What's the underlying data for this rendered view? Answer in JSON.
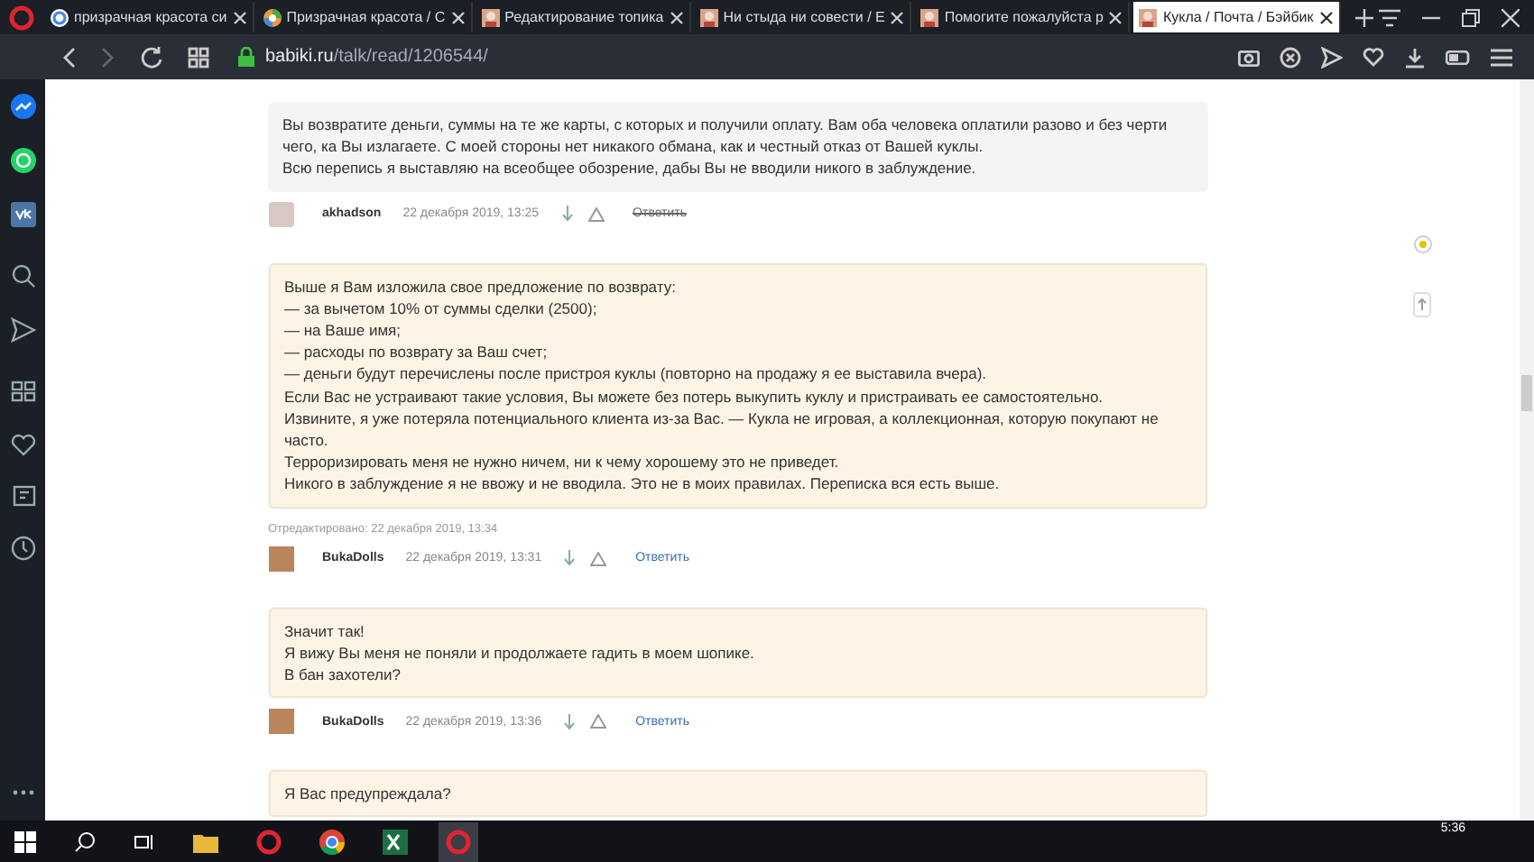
{
  "browser": {
    "tabs": [
      {
        "title": "призрачная красота си",
        "selected": false,
        "kind": "g"
      },
      {
        "title": "Призрачная красота / С",
        "selected": false,
        "kind": "wheel"
      },
      {
        "title": "Редактирование топика",
        "selected": false,
        "kind": "site"
      },
      {
        "title": "Ни стыда ни совести / Е",
        "selected": false,
        "kind": "site"
      },
      {
        "title": "Помогите пожалуйста р",
        "selected": false,
        "kind": "site"
      },
      {
        "title": "Кукла / Почта / Бэйбик",
        "selected": true,
        "kind": "site"
      }
    ],
    "address": {
      "host": "babiki.ru",
      "path": "/talk/read/1206544/"
    }
  },
  "comments": [
    {
      "kind": "other",
      "paragraphs": [
        "Вы возвратите деньги, суммы на те же карты, с которых и получили оплату. Вам оба человека оплатили разово и без черти чего, ка Вы излагаете. С моей стороны нет никакого обмана, как и честный отказ от Вашей куклы.",
        "Всю перепись я выставляю на всеобщее обозрение, дабы Вы не вводили никого в заблуждение."
      ],
      "author": "akhadson",
      "date": "22 декабря 2019, 13:25",
      "reply": "Ответить",
      "reply_disabled": true
    },
    {
      "kind": "own",
      "paragraphs": [
        "Выше я Вам изложила свое предложение по возврату:",
        "— за вычетом 10% от суммы сделки (2500);",
        "— на Ваше имя;",
        "— расходы по возврату за Ваш счет;",
        "— деньги будут перечислены после пристроя куклы (повторно на продажу я ее выставила вчера).",
        "Если Вас не устраивают такие условия, Вы можете без потерь выкупить куклу и пристраивать ее самостоятельно.",
        "Извините, я уже потеряла потенциального клиента из-за Вас. — Кукла не игровая, а коллекционная, которую покупают не часто.",
        "Терроризировать меня не нужно ничем, ни к чему хорошему это не приведет.",
        "Никого в заблуждение я не ввожу и не вводила. Это не в моих правилах. Переписка вся есть выше."
      ],
      "edited": "Отредактировано: 22 декабря 2019, 13:34",
      "author": "BukaDolls",
      "date": "22 декабря 2019, 13:31",
      "reply": "Ответить",
      "reply_disabled": false
    },
    {
      "kind": "own",
      "paragraphs": [
        "Значит так!",
        "Я вижу Вы меня не поняли и продолжаете гадить в моем шопике.",
        "В бан захотели?"
      ],
      "author": "BukaDolls",
      "date": "22 декабря 2019, 13:36",
      "reply": "Ответить",
      "reply_disabled": false
    },
    {
      "kind": "own",
      "paragraphs": [
        "Я Вас предупреждала?"
      ]
    }
  ],
  "taskbar": {
    "time": "5:36"
  }
}
